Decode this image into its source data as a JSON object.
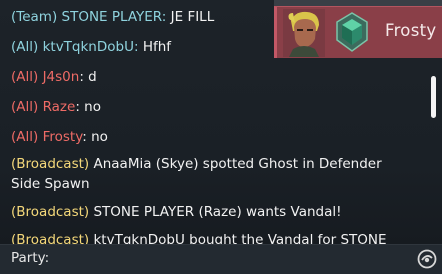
{
  "colors": {
    "team": "#8fd3de",
    "all": "#8fd3de",
    "all_enemy": "#ee6b66",
    "broadcast": "#f4d87a",
    "text": "#f2f2f2"
  },
  "chat": {
    "messages": [
      {
        "channel": "(Team)",
        "sender": "STONE PLAYER",
        "separator": ":",
        "text": " JE FILL"
      },
      {
        "channel": "(All)",
        "sender": "ktvTqknDobU",
        "separator": ":",
        "text": " Hfhf"
      },
      {
        "channel": "(All)",
        "sender": "J4s0n",
        "separator": ":",
        "text": " d"
      },
      {
        "channel": "(All)",
        "sender": "Raze",
        "separator": ":",
        "text": " no"
      },
      {
        "channel": "(All)",
        "sender": "Frosty",
        "separator": ":",
        "text": " no"
      },
      {
        "channel": "(Broadcast)",
        "text": " AnaaMia (Skye) spotted Ghost in Defender Side Spawn"
      },
      {
        "channel": "(Broadcast)",
        "text": " STONE PLAYER (Raze) wants Vandal!"
      },
      {
        "channel": "(Broadcast)",
        "text": " ktvTqknDobU bought the Vandal for STONE"
      }
    ]
  },
  "player_card": {
    "name": "Frosty",
    "agent_icon": "agent-portrait-icon",
    "rank_icon": "rank-emerald-icon"
  },
  "input": {
    "label": "Party:",
    "value": "",
    "icon": "chat-mode-icon"
  }
}
